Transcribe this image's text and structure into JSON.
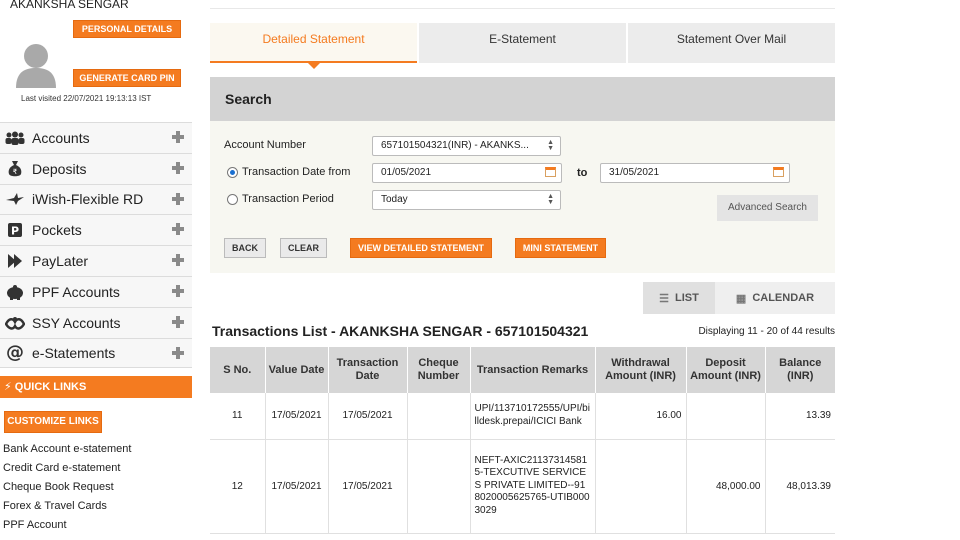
{
  "user": {
    "name": "AKANKSHA SENGAR",
    "personal_details_label": "PERSONAL DETAILS",
    "card_pin_label": "GENERATE CARD PIN",
    "last_visited": "Last visited 22/07/2021 19:13:13 IST"
  },
  "sidebar": {
    "items": [
      {
        "label": "Accounts",
        "icon": "accounts-icon"
      },
      {
        "label": "Deposits",
        "icon": "deposits-icon"
      },
      {
        "label": "iWish-Flexible RD",
        "icon": "iwish-icon"
      },
      {
        "label": "Pockets",
        "icon": "pockets-icon"
      },
      {
        "label": "PayLater",
        "icon": "paylater-icon"
      },
      {
        "label": "PPF Accounts",
        "icon": "ppf-icon"
      },
      {
        "label": "SSY Accounts",
        "icon": "ssy-icon"
      },
      {
        "label": "e-Statements",
        "icon": "estatements-icon"
      }
    ],
    "quick_links_title": "QUICK LINKS",
    "customize_label": "CUSTOMIZE LINKS",
    "quick_links": [
      "Bank Account e-statement",
      "Credit Card e-statement",
      "Cheque Book Request",
      "Forex & Travel Cards",
      "PPF Account"
    ]
  },
  "tabs": [
    {
      "label": "Detailed Statement",
      "active": true
    },
    {
      "label": "E-Statement",
      "active": false
    },
    {
      "label": "Statement Over Mail",
      "active": false
    }
  ],
  "search": {
    "title": "Search",
    "account_label": "Account Number",
    "account_value": "657101504321(INR) - AKANKS...",
    "date_from_label": "Transaction Date from",
    "date_from": "01/05/2021",
    "to_label": "to",
    "date_to": "31/05/2021",
    "period_label": "Transaction Period",
    "period_value": "Today",
    "advanced_label": "Advanced Search",
    "back_label": "BACK",
    "clear_label": "CLEAR",
    "view_detailed_label": "VIEW DETAILED STATEMENT",
    "mini_label": "MINI STATEMENT"
  },
  "view_toggle": {
    "list_label": "LIST",
    "calendar_label": "CALENDAR"
  },
  "transactions": {
    "title": "Transactions List - AKANKSHA SENGAR - 657101504321",
    "count": "Displaying 11 - 20 of 44 results",
    "headers": [
      "S No.",
      "Value Date",
      "Transaction Date",
      "Cheque Number",
      "Transaction Remarks",
      "Withdrawal Amount (INR)",
      "Deposit Amount (INR)",
      "Balance (INR)"
    ],
    "rows": [
      {
        "sno": "11",
        "value_date": "17/05/2021",
        "txn_date": "17/05/2021",
        "cheque": "",
        "remarks": "UPI/113710172555/UPI/billdesk.prepai/ICICI Bank",
        "withdrawal": "16.00",
        "deposit": "",
        "balance": "13.39"
      },
      {
        "sno": "12",
        "value_date": "17/05/2021",
        "txn_date": "17/05/2021",
        "cheque": "",
        "remarks": "NEFT-AXIC211373145815-TEXCUTIVE SERVICES PRIVATE LIMITED--918020005625765-UTIB0003029",
        "withdrawal": "",
        "deposit": "48,000.00",
        "balance": "48,013.39"
      }
    ]
  },
  "colors": {
    "accent": "#f47b20",
    "header_grey": "#d3d3d3",
    "panel_bg": "#f7f7f1"
  }
}
